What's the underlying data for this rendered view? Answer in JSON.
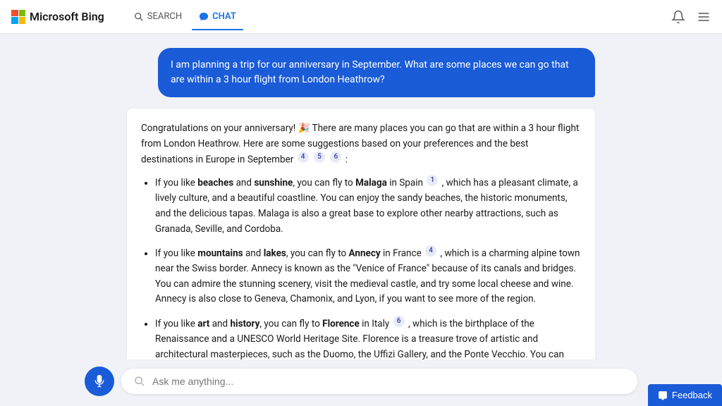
{
  "header": {
    "logo_text": "Microsoft Bing",
    "nav_items": [
      {
        "id": "search",
        "label": "SEARCH",
        "active": false
      },
      {
        "id": "chat",
        "label": "CHAT",
        "active": true
      }
    ]
  },
  "user_message": {
    "text": "I am planning a trip for our anniversary in September. What are some places we can go that are within a 3 hour flight from London Heathrow?"
  },
  "bot_message": {
    "intro": "Congratulations on your anniversary! 🎉 There are many places you can go that are within a 3 hour flight from London Heathrow. Here are some suggestions based on your preferences and the best destinations in Europe in September",
    "intro_citations": [
      4,
      5,
      6
    ],
    "items": [
      {
        "keyword1": "beaches",
        "keyword2": "sunshine",
        "dest": "Malaga",
        "country": "Spain",
        "citation": 1,
        "text": ", which has a pleasant climate, a lively culture, and a beautiful coastline. You can enjoy the sandy beaches, the historic monuments, and the delicious tapas. Malaga is also a great base to explore other nearby attractions, such as Granada, Seville, and Cordoba."
      },
      {
        "keyword1": "mountains",
        "keyword2": "lakes",
        "dest": "Annecy",
        "country": "France",
        "citation": 4,
        "text": ", which is a charming alpine town near the Swiss border. Annecy is known as the \"Venice of France\" because of its canals and bridges. You can admire the stunning scenery, visit the medieval castle, and try some local cheese and wine. Annecy is also close to Geneva, Chamonix, and Lyon, if you want to see more of the region."
      },
      {
        "keyword1": "art",
        "keyword2": "history",
        "dest": "Florence",
        "country": "Italy",
        "citation": 6,
        "text": ", which is the birthplace of the Renaissance and a UNESCO World Heritage Site. Florence is a treasure trove of artistic and architectural masterpieces, such as the Duomo, the Uffizi Gallery, and the Ponte Vecchio. You can also explore the Tuscan countryside, taste the famous gelato, and shop for leather goods."
      }
    ]
  },
  "input": {
    "placeholder": "Ask me anything..."
  },
  "feedback": {
    "label": "Feedback"
  }
}
